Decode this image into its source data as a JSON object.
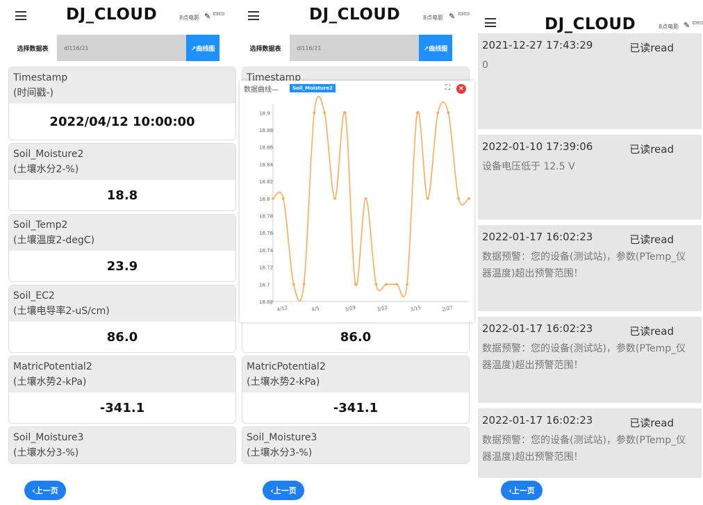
{
  "app": {
    "title": "DJ_CLOUD",
    "user_label": "8点电影",
    "edit_icon": "✎",
    "view_icon": "▭▭"
  },
  "toolbar": {
    "select_label": "选择数据表",
    "selected_value": "dl116/21",
    "chart_button": "↗曲线图"
  },
  "cards": [
    {
      "name": "Timestamp",
      "unit": "(时间戳-)",
      "value": "2022/04/12 10:00:00"
    },
    {
      "name": "Soil_Moisture2",
      "unit": "(土壤水分2-%)",
      "value": "18.8"
    },
    {
      "name": "Soil_Temp2",
      "unit": "(土壤温度2-degC)",
      "value": "23.9"
    },
    {
      "name": "Soil_EC2",
      "unit": "(土壤电导率2-uS/cm)",
      "value": "86.0"
    },
    {
      "name": "MatricPotential2",
      "unit": "(土壤水势2-kPa)",
      "value": "-341.1"
    },
    {
      "name": "Soil_Moisture3",
      "unit": "(土壤水分3-%)",
      "value": ""
    }
  ],
  "back_button": "‹上一页",
  "chart_popup": {
    "title": "数据曲线—",
    "tag": "Soil_Moisture2",
    "expand_icon": "⛶",
    "close_icon": "×"
  },
  "chart_data": {
    "type": "line",
    "title": "",
    "xlabel": "",
    "ylabel": "",
    "series_color": "#ffa64d",
    "ylim": [
      18.68,
      18.91
    ],
    "yticks": [
      "18.9",
      "18.88",
      "18.86",
      "18.84",
      "18.82",
      "18.8",
      "18.78",
      "18.76",
      "18.74",
      "18.72",
      "18.7",
      "18.68"
    ],
    "xticks": [
      "4/12",
      "4/5",
      "3/29",
      "3/22",
      "3/15",
      "2/27"
    ],
    "values": [
      18.8,
      18.8,
      18.7,
      18.7,
      18.9,
      18.9,
      18.8,
      18.9,
      18.7,
      18.8,
      18.7,
      18.7,
      18.7,
      18.7,
      18.9,
      18.8,
      18.9,
      18.9,
      18.8,
      18.8
    ]
  },
  "messages": [
    {
      "time": "2021-12-27 17:43:29",
      "status": "已读read",
      "body": "0"
    },
    {
      "time": "2022-01-10 17:39:06",
      "status": "已读read",
      "body": "设备电压低于 12.5 V"
    },
    {
      "time": "2022-01-17 16:02:23",
      "status": "已读read",
      "body": "数据预警：您的设备(测试站)，参数(PTemp_仪器温度)超出预警范围！"
    },
    {
      "time": "2022-01-17 16:02:23",
      "status": "已读read",
      "body": "数据预警：您的设备(测试站)，参数(PTemp_仪器温度)超出预警范围！"
    },
    {
      "time": "2022-01-17 16:02:23",
      "status": "已读read",
      "body": "数据预警：您的设备(测试站)，参数(PTemp_仪器温度)超出预警范围！"
    }
  ]
}
